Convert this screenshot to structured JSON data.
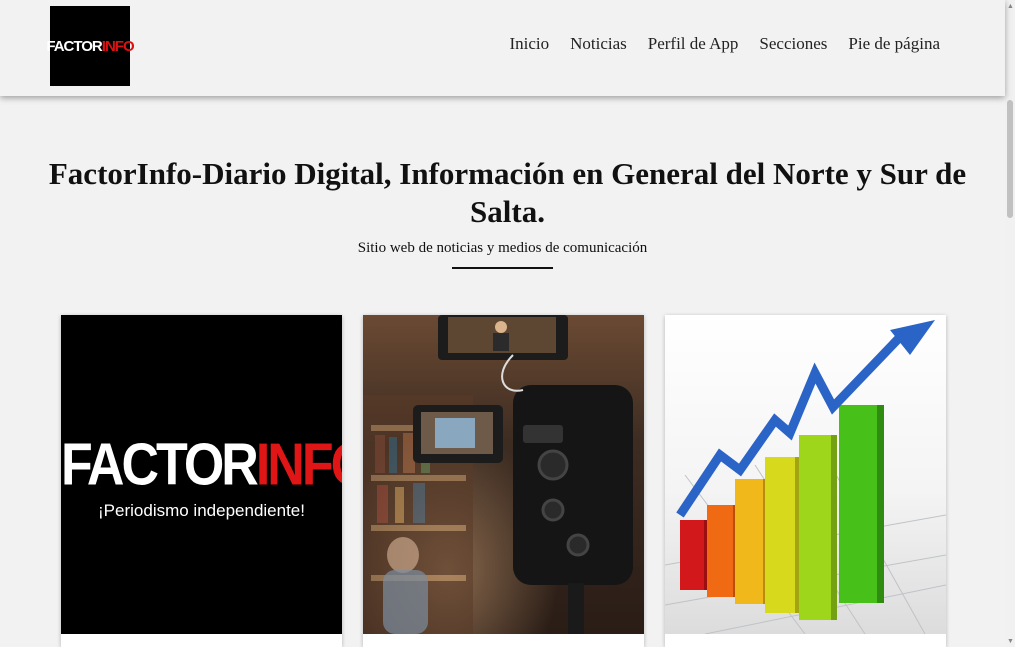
{
  "header": {
    "logo_text_white": "FACTOR",
    "logo_text_red": "INFO",
    "nav": [
      "Inicio",
      "Noticias",
      "Perfil de App",
      "Secciones",
      "Pie de página"
    ]
  },
  "hero": {
    "title": "FactorInfo-Diario Digital, Información en General del Norte y Sur de Salta.",
    "subtitle": "Sitio web de noticias y medios de comunicación"
  },
  "cards": [
    {
      "logo_white": "FACTOR",
      "logo_red": "INFO",
      "tagline": "¡Periodismo independiente!"
    },
    {},
    {}
  ],
  "colors": {
    "brand_red": "#e01515",
    "background": "#f2f2f2"
  }
}
